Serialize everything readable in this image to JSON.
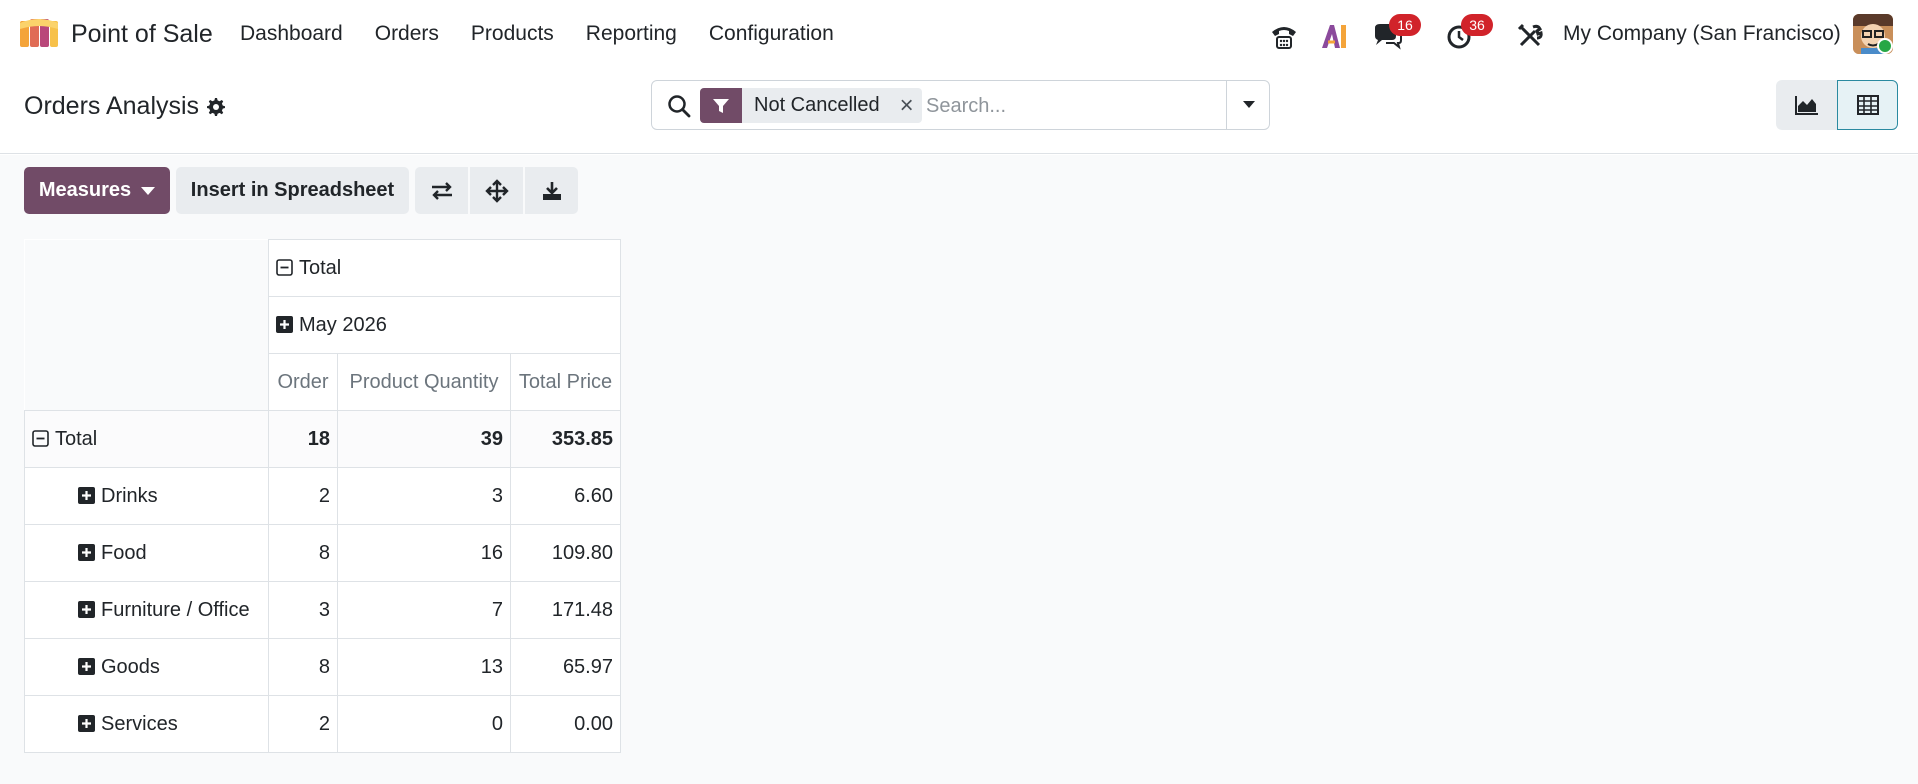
{
  "navbar": {
    "app_name": "Point of Sale",
    "menu": [
      "Dashboard",
      "Orders",
      "Products",
      "Reporting",
      "Configuration"
    ],
    "badges": {
      "messages": "16",
      "activities": "36"
    },
    "company": "My Company (San Francisco)"
  },
  "control": {
    "title": "Orders Analysis",
    "facet": "Not Cancelled",
    "search_placeholder": "Search..."
  },
  "toolbar": {
    "measures_label": "Measures",
    "insert_label": "Insert in Spreadsheet"
  },
  "pivot": {
    "col_total": "Total",
    "col_group": "May 2026",
    "measures": [
      "Order",
      "Product Quantity",
      "Total Price"
    ],
    "total_row": {
      "label": "Total",
      "values": [
        "18",
        "39",
        "353.85"
      ]
    },
    "rows": [
      {
        "label": "Drinks",
        "values": [
          "2",
          "3",
          "6.60"
        ]
      },
      {
        "label": "Food",
        "values": [
          "8",
          "16",
          "109.80"
        ]
      },
      {
        "label": "Furniture / Office",
        "values": [
          "3",
          "7",
          "171.48"
        ]
      },
      {
        "label": "Goods",
        "values": [
          "8",
          "13",
          "65.97"
        ]
      },
      {
        "label": "Services",
        "values": [
          "2",
          "0",
          "0.00"
        ]
      }
    ]
  },
  "colors": {
    "primary": "#714b67",
    "badge": "#d1232a",
    "active_view": "#2a8aa0"
  }
}
